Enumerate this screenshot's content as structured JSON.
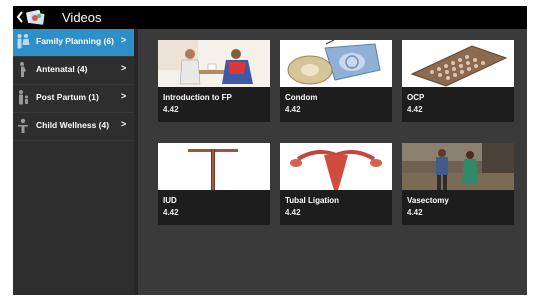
{
  "header": {
    "back_icon": "chevron-left-icon",
    "app_icon": "app-logo-icon",
    "title": "Videos"
  },
  "sidebar": {
    "items": [
      {
        "label": "Family Planning (6)",
        "icon": "family-icon",
        "active": true
      },
      {
        "label": "Antenatal (4)",
        "icon": "pregnant-woman-icon",
        "active": false
      },
      {
        "label": "Post Partum (1)",
        "icon": "mother-child-icon",
        "active": false
      },
      {
        "label": "Child Wellness (4)",
        "icon": "child-icon",
        "active": false
      }
    ],
    "chevron": ">",
    "accent": "#2f90c9"
  },
  "videos": [
    {
      "title": "Introduction to FP",
      "subtitle": "4.42",
      "thumb": "counseling-illustration"
    },
    {
      "title": "Condom",
      "subtitle": "4.42",
      "thumb": "condom-illustration"
    },
    {
      "title": "OCP",
      "subtitle": "4.42",
      "thumb": "pill-pack-illustration"
    },
    {
      "title": "IUD",
      "subtitle": "4.42",
      "thumb": "iud-illustration"
    },
    {
      "title": "Tubal Ligation",
      "subtitle": "4.42",
      "thumb": "uterus-illustration"
    },
    {
      "title": "Vasectomy",
      "subtitle": "4.42",
      "thumb": "couple-photo"
    }
  ]
}
